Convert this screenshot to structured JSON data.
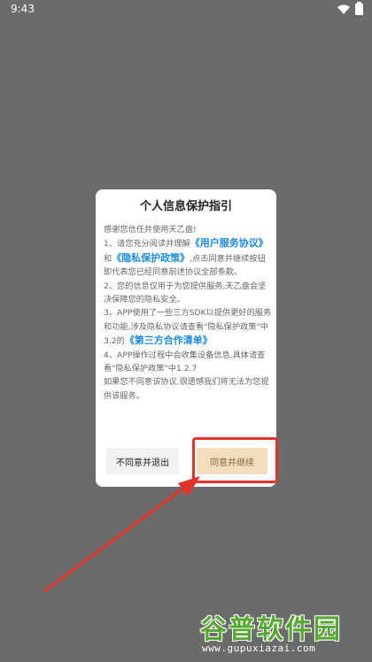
{
  "status_bar": {
    "time": "9:43"
  },
  "dialog": {
    "title": "个人信息保护指引",
    "greeting": "感谢您信任并使用天乙盘!",
    "p1_before": "1、请您充分阅读并理解",
    "link_user_agreement": "《用户服务协议》",
    "p1_and": "和",
    "link_privacy_policy": "《隐私保护政策》",
    "p1_after": ",点击同意并继续按钮即代表您已经同意前述协议全部条款。",
    "p2": "2、您的信息仅用于为您提供服务,天乙盘会坚决保障您的隐私安全。",
    "p3_before": "3、APP使用了一些三方SDK以提供更好的服务和功能,涉及隐私协议请查看\"隐私保护政策\"中3.2的",
    "link_third_party": "《第三方合作清单》",
    "p4": "4、APP操作过程中会收集设备信息,具体请查看\"隐私保护政策\"中1.2.7",
    "p5": "如果您不同意该协议,很遗憾我们将无法为您提供该服务。",
    "decline_label": "不同意并退出",
    "accept_label": "同意并继续"
  },
  "annotation": {
    "color": "#e5332a"
  },
  "watermark": {
    "brand": "谷普软件园",
    "url": "www.gupuxiazai.com"
  }
}
